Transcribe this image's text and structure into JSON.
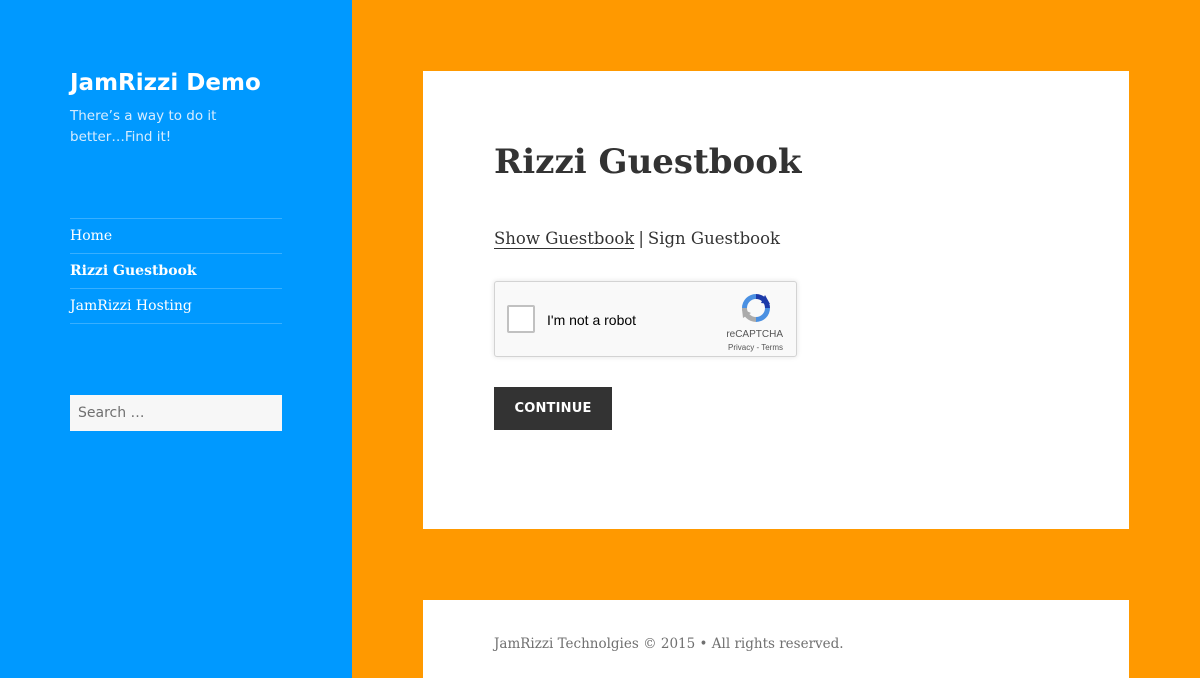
{
  "colors": {
    "sidebar_bg": "#0099ff",
    "page_bg": "#ff9900",
    "card_bg": "#ffffff",
    "button_bg": "#333333",
    "text": "#333333"
  },
  "site": {
    "title": "JamRizzi Demo",
    "tagline": "There’s a way to do it better…Find it!"
  },
  "nav": {
    "items": [
      {
        "label": "Home",
        "active": false
      },
      {
        "label": "Rizzi Guestbook",
        "active": true
      },
      {
        "label": "JamRizzi Hosting",
        "active": false
      }
    ]
  },
  "search": {
    "placeholder": "Search …",
    "value": ""
  },
  "main": {
    "title": "Rizzi Guestbook",
    "links": {
      "show": "Show Guestbook",
      "separator": "|",
      "sign": "Sign Guestbook"
    },
    "recaptcha": {
      "label": "I'm not a robot",
      "brand": "reCAPTCHA",
      "privacy": "Privacy",
      "dash": " - ",
      "terms": "Terms",
      "checked": false,
      "icon": "recaptcha-logo-icon"
    },
    "continue_label": "CONTINUE"
  },
  "footer": {
    "text": "JamRizzi Technolgies © 2015 • All rights reserved."
  }
}
